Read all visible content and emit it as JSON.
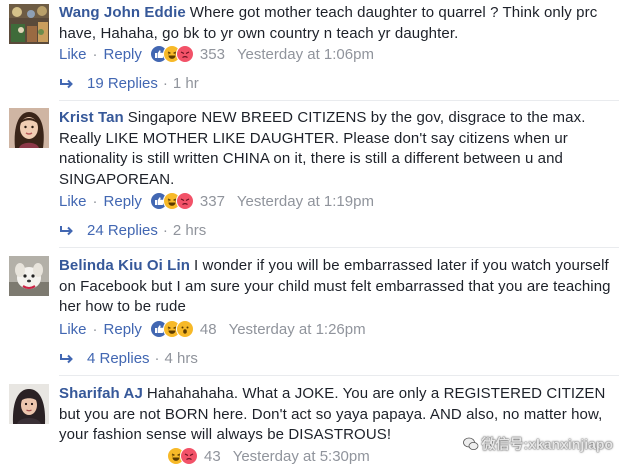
{
  "comments": [
    {
      "author": "Wang John Eddie",
      "text": "Where got mother teach daughter to quarrel ? Think only prc have, Hahaha, go bk to yr own country n teach yr daughter.",
      "like_label": "Like",
      "reply_label": "Reply",
      "reactions": [
        "like",
        "haha",
        "angry"
      ],
      "reaction_count": "353",
      "timestamp": "Yesterday at 1:06pm",
      "replies_label": "19 Replies",
      "replies_time": "1 hr"
    },
    {
      "author": "Krist Tan",
      "text": "Singapore NEW BREED CITIZENS by the gov, disgrace to the max. Really LIKE MOTHER LIKE DAUGHTER. Please don't say citizens when ur nationality is still written CHINA on it, there is still a different between u and SINGAPOREAN.",
      "like_label": "Like",
      "reply_label": "Reply",
      "reactions": [
        "like",
        "haha",
        "angry"
      ],
      "reaction_count": "337",
      "timestamp": "Yesterday at 1:19pm",
      "replies_label": "24 Replies",
      "replies_time": "2 hrs"
    },
    {
      "author": "Belinda Kiu Oi Lin",
      "text": "I wonder if you will be embarrassed later if you watch yourself on Facebook but I am sure your child must felt embarrassed that you are teaching her how to be rude",
      "like_label": "Like",
      "reply_label": "Reply",
      "reactions": [
        "like",
        "haha",
        "wow"
      ],
      "reaction_count": "48",
      "timestamp": "Yesterday at 1:26pm",
      "replies_label": "4 Replies",
      "replies_time": "4 hrs"
    },
    {
      "author": "Sharifah AJ",
      "text": "Hahahahaha. What a JOKE. You are only a REGISTERED CITIZEN but you are not BORN here. Don't act so yaya papaya. AND also, no matter how, your fashion sense will always be DISASTROUS!",
      "reactions": [
        "haha",
        "angry"
      ],
      "reaction_count": "43",
      "timestamp": "Yesterday at 5:30pm"
    }
  ],
  "watermark": "微信号:xkanxinjiapo",
  "colors": {
    "author": "#365899",
    "link": "#4267b2",
    "meta": "#90949c",
    "like_reaction": "#4267b2",
    "haha_reaction": "#f7b928",
    "angry_reaction": "#f25268"
  }
}
